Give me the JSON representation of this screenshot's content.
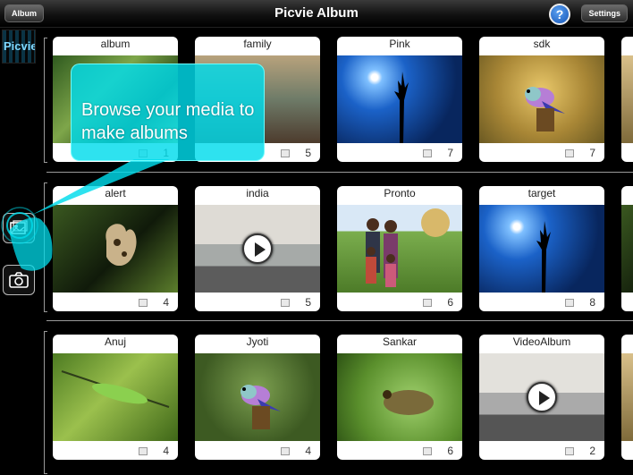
{
  "topbar": {
    "album_button": "Album",
    "title": "Picvie Album",
    "help_label": "?",
    "settings_button": "Settings"
  },
  "sidebar": {
    "logo_text": "Picvie",
    "gallery_icon": "gallery-icon",
    "camera_icon": "camera-icon"
  },
  "callout": {
    "message": "Browse your media to make albums"
  },
  "albums": [
    {
      "name": "album",
      "count": "1"
    },
    {
      "name": "family",
      "count": "5"
    },
    {
      "name": "Pink",
      "count": "7"
    },
    {
      "name": "sdk",
      "count": "7"
    },
    {
      "name": "alert",
      "count": "4"
    },
    {
      "name": "india",
      "count": "5"
    },
    {
      "name": "Pronto",
      "count": "6"
    },
    {
      "name": "target",
      "count": "8"
    },
    {
      "name": "Anuj",
      "count": "4"
    },
    {
      "name": "Jyoti",
      "count": "4"
    },
    {
      "name": "Sankar",
      "count": "6"
    },
    {
      "name": "VideoAlbum",
      "count": "2"
    }
  ],
  "colors": {
    "callout": "#00dceb",
    "help": "#1656b8"
  }
}
